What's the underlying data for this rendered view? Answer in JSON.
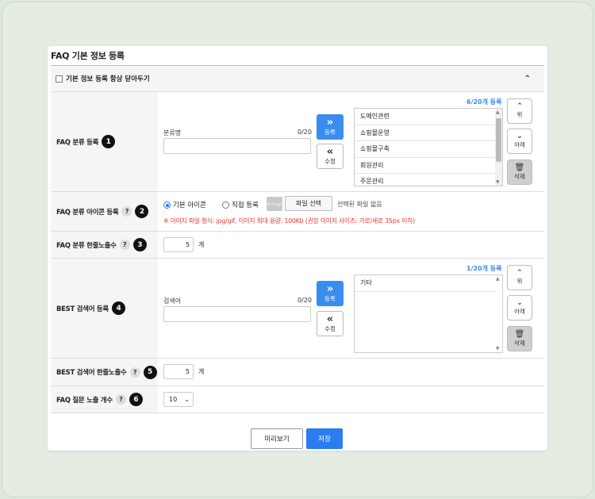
{
  "page_title": "FAQ 기본 정보 등록",
  "collapse_label": "기본 정보 등록 항상 닫아두기",
  "collapse_icon": "chevron-up-icon",
  "rows": {
    "category": {
      "label": "FAQ 분류 등록",
      "num": "1"
    },
    "icon": {
      "label": "FAQ 분류 아이콘 등록",
      "num": "2"
    },
    "category_count": {
      "label": "FAQ 분류 한줄노출수",
      "num": "3"
    },
    "best": {
      "label": "BEST 검색어 등록",
      "num": "4"
    },
    "best_count": {
      "label": "BEST 검색어 한줄노출수",
      "num": "5"
    },
    "question_count": {
      "label": "FAQ 질문 노출 개수",
      "num": "6"
    }
  },
  "help_mark": "?",
  "category": {
    "field_label": "분류명",
    "field_counter": "0/20",
    "value": "",
    "register": "등록",
    "edit": "수정",
    "count_text": "6/20개 등록",
    "items": [
      "도메인관련",
      "쇼핑몰운영",
      "쇼핑몰구축",
      "회원관리",
      "주문관리"
    ]
  },
  "side_buttons": {
    "up": "위",
    "down": "아래",
    "delete": "삭제"
  },
  "icon_row": {
    "opt_default": "기본 아이콘",
    "opt_custom": "직접 등록",
    "noimg_text": "No Image",
    "file_button": "파일 선택",
    "file_status": "선택된 파일 없음",
    "notice": "※ 이미지 파일 형식: jpg/gif, 이미지 최대 용량: 100Kb (권장 이미지 사이즈: 가로/세로 35px 이하)"
  },
  "category_count": {
    "value": "5",
    "unit": "개"
  },
  "best": {
    "field_label": "검색어",
    "field_counter": "0/20",
    "value": "",
    "register": "등록",
    "edit": "수정",
    "count_text": "1/20개 등록",
    "items": [
      "기타"
    ]
  },
  "best_count": {
    "value": "5",
    "unit": "개"
  },
  "question_count": {
    "value": "10"
  },
  "footer": {
    "preview": "미리보기",
    "save": "저장"
  }
}
